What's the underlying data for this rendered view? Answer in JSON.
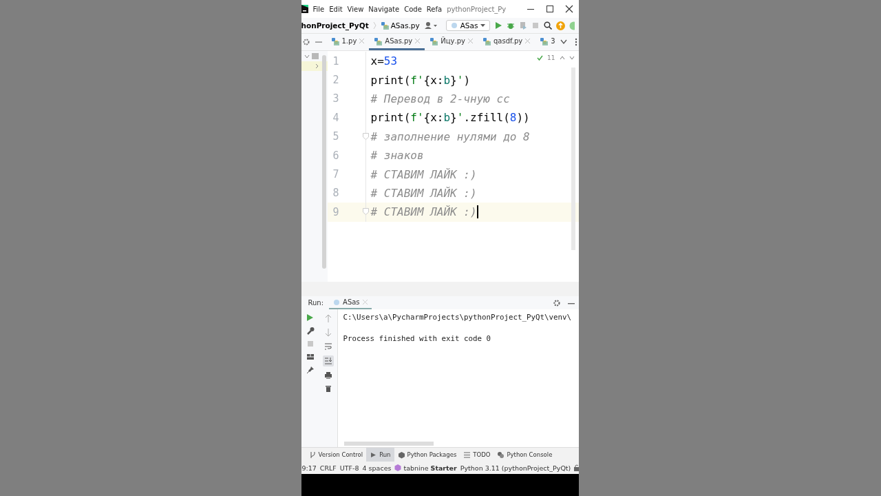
{
  "title_bar": {
    "menu": [
      "File",
      "Edit",
      "View",
      "Navigate",
      "Code",
      "Refa"
    ],
    "title": "pythonProject_Py"
  },
  "nav_bar": {
    "breadcrumbs": [
      "honProject_PyQt",
      "ASas.py"
    ],
    "run_config": "ASas"
  },
  "editor_tabs": [
    {
      "label": "1.py",
      "selected": false
    },
    {
      "label": "ASas.py",
      "selected": true
    },
    {
      "label": "Йцу.py",
      "selected": false
    },
    {
      "label": "qasdf.py",
      "selected": false
    },
    {
      "label": "3",
      "selected": false
    }
  ],
  "inspections": {
    "count": "11"
  },
  "code_lines": [
    {
      "number": "1",
      "current": false,
      "fold_marker": false,
      "tokens": [
        {
          "kind": "plain",
          "text": "x="
        },
        {
          "kind": "number",
          "text": "53"
        }
      ]
    },
    {
      "number": "2",
      "current": false,
      "fold_marker": false,
      "tokens": [
        {
          "kind": "plain",
          "text": "print("
        },
        {
          "kind": "string",
          "text": "f'"
        },
        {
          "kind": "plain",
          "text": "{x:"
        },
        {
          "kind": "format",
          "text": "b"
        },
        {
          "kind": "plain",
          "text": "}"
        },
        {
          "kind": "string",
          "text": "'"
        },
        {
          "kind": "plain",
          "text": ")"
        }
      ]
    },
    {
      "number": "3",
      "current": false,
      "fold_marker": false,
      "tokens": [
        {
          "kind": "comment",
          "text": "# Перевод в 2-чную сс"
        }
      ]
    },
    {
      "number": "4",
      "current": false,
      "fold_marker": false,
      "tokens": [
        {
          "kind": "plain",
          "text": "print("
        },
        {
          "kind": "string",
          "text": "f'"
        },
        {
          "kind": "plain",
          "text": "{x:"
        },
        {
          "kind": "format",
          "text": "b"
        },
        {
          "kind": "plain",
          "text": "}"
        },
        {
          "kind": "string",
          "text": "'"
        },
        {
          "kind": "plain",
          "text": ".zfill("
        },
        {
          "kind": "number",
          "text": "8"
        },
        {
          "kind": "plain",
          "text": "))"
        }
      ]
    },
    {
      "number": "5",
      "current": false,
      "fold_marker": true,
      "tokens": [
        {
          "kind": "comment",
          "text": "# заполнение нулями до 8"
        }
      ]
    },
    {
      "number": "6",
      "current": false,
      "fold_marker": false,
      "tokens": [
        {
          "kind": "comment",
          "text": "# знаков"
        }
      ]
    },
    {
      "number": "7",
      "current": false,
      "fold_marker": false,
      "tokens": [
        {
          "kind": "comment",
          "text": "# СТАВИМ ЛАЙК :)"
        }
      ]
    },
    {
      "number": "8",
      "current": false,
      "fold_marker": false,
      "tokens": [
        {
          "kind": "comment",
          "text": "# СТАВИМ ЛАЙК :)"
        }
      ]
    },
    {
      "number": "9",
      "current": true,
      "fold_marker": true,
      "tokens": [
        {
          "kind": "comment",
          "text": "# СТАВИМ ЛАЙК :)"
        }
      ]
    }
  ],
  "run_panel": {
    "label": "Run:",
    "tab": "ASas",
    "output": [
      "C:\\Users\\a\\PycharmProjects\\pythonProject_PyQt\\venv\\",
      "Process finished with exit code 0"
    ]
  },
  "tool_windows": [
    {
      "label": "Version Control",
      "selected": false
    },
    {
      "label": "Run",
      "selected": true
    },
    {
      "label": "Python Packages",
      "selected": false
    },
    {
      "label": "TODO",
      "selected": false
    },
    {
      "label": "Python Console",
      "selected": false
    }
  ],
  "status_bar": {
    "items": [
      "9:17",
      "CRLF",
      "UTF-8",
      "4 spaces"
    ],
    "plugin": "tabnine **Starter**",
    "interpreter": "Python 3.11 (pythonProject_PyQt)"
  }
}
